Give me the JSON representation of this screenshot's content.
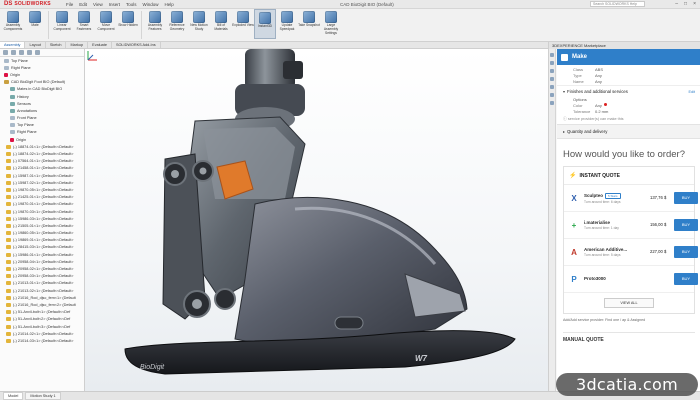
{
  "titlebar": {
    "brand": "SOLIDWORKS",
    "menus": [
      "File",
      "Edit",
      "View",
      "Insert",
      "Tools",
      "Window",
      "Help"
    ],
    "doc_title": "CAD BioDigit BIO (Default)",
    "search_placeholder": "Search SOLIDWORKS Help"
  },
  "ribbon": {
    "buttons": [
      "Assembly Components",
      "Mate",
      "Linear Component",
      "Smart Fasteners",
      "Move Component",
      "Show Hidden",
      "Assembly Features",
      "Reference Geometry",
      "New Motion Study",
      "Bill of Materials",
      "Exploded View",
      "Instant3D",
      "Update Speedpak",
      "Take Snapshot",
      "Large Assembly Settings"
    ],
    "active_index": 11
  },
  "cmdtabs": [
    "Assembly",
    "Layout",
    "Sketch",
    "Markup",
    "Evaluate",
    "SOLIDWORKS Add-Ins"
  ],
  "cmdtabs_active": 0,
  "tree": {
    "top": [
      "Top Plane",
      "Right Plane",
      "Origin"
    ],
    "root": "CAD BioDigit Foot BIO (Default)",
    "children": [
      "Mates in CAD BioDigit BIO",
      "History",
      "Sensors",
      "Annotations",
      "Front Plane",
      "Top Plane",
      "Right Plane",
      "Origin"
    ],
    "parts": [
      "(-) 18874-01<1> (Default<<Default>",
      "(-) 18874-02<1> (Default<<Default>",
      "(-) 07564-01<1> (Default<<Default>",
      "(-) 21458-01<1> (Default<<Default>",
      "(-) 15987-01<1> (Default<<Default>",
      "(-) 15987-02<1> (Default<<Default>",
      "(-) 19870-05<1> (Default<<Default>",
      "(-) 21425-01<1> (Default<<Default>",
      "(-) 19870-01<1> (Default<<Default>",
      "(-) 19870-03<1> (Default<<Default>",
      "(-) 15986-03<1> (Default<<Default>",
      "(-) 21505-01<1> (Default<<Default>",
      "(-) 19860-05<1> (Default<<Default>",
      "(-) 19869-01<1> (Default<<Default>",
      "(-) 28415-03<1> (Default<<Default>",
      "(-) 15986-01<1> (Default<<Default>",
      "(-) 20958-04<1> (Default<<Default>",
      "(-) 20958-02<1> (Default<<Default>",
      "(-) 20958-03<1> (Default<<Default>",
      "(-) 21013-01<1> (Default<<Default>",
      "(-) 21013-02<1> (Default<<Default>",
      "(-) 21016_Rod_djsc_fem<1> (Default",
      "(-) 21016_Rod_djsc_fem<2> (Default",
      "(-) 51-Anvil-bolt<1> (Default<<Def",
      "(-) 51-Anvil-bolt<2> (Default<<Def",
      "(-) 51-Anvil-bolt<3> (Default<<Def",
      "(-) 21014-02<1> (Default<<Default>",
      "(-) 21014-03<1> (Default<<Default>"
    ]
  },
  "bottomtabs": [
    "Model",
    "Motion Study 1"
  ],
  "panel": {
    "header": "3DEXPERIENCE Marketplace",
    "brand": "Make",
    "specs": [
      {
        "k": "Class",
        "v": "ABS"
      },
      {
        "k": "Type",
        "v": "Any"
      },
      {
        "k": "Name",
        "v": "Any"
      }
    ],
    "finishes_title": "Finishes and additional services",
    "edit_label": "Edit",
    "options_title": "Options",
    "finish_specs": [
      {
        "k": "Color",
        "v": "Any"
      },
      {
        "k": "Tolerance",
        "v": "0.2 mm"
      }
    ],
    "provider_note": "service provider(s) can make this",
    "qd_label": "Quantity and delivery",
    "headline": "How would you like to order?",
    "instant_quote": "INSTANT QUOTE",
    "quotes": [
      {
        "name": "Sculpteo",
        "tag": "5 Stars",
        "sub": "Turn around time: 6 days",
        "price": "137,76 $",
        "buy": "BUY",
        "logo": "X",
        "color": "#2f5fae"
      },
      {
        "name": "i.materialise",
        "tag": "",
        "sub": "Turn around time: 1 day",
        "price": "156,00 $",
        "buy": "BUY",
        "logo": "+",
        "color": "#2aa84a"
      },
      {
        "name": "American Additive...",
        "tag": "",
        "sub": "Turn around time: 5 days",
        "price": "227,00 $",
        "buy": "BUY",
        "logo": "A",
        "color": "#c0392b"
      },
      {
        "name": "Proto3000",
        "tag": "",
        "sub": "",
        "price": "",
        "buy": "BUY",
        "logo": "P",
        "color": "#2f7fc9"
      }
    ],
    "view_all": "VIEW ALL",
    "add_provider": "Add/Add service provider: Find one / ap & Assigned",
    "manual_quote": "MANUAL QUOTE"
  },
  "watermark": "3dcatia.com",
  "colors": {
    "accent": "#2f7fc9",
    "brand_red": "#d21f26",
    "orange_part": "#e07a2b"
  }
}
